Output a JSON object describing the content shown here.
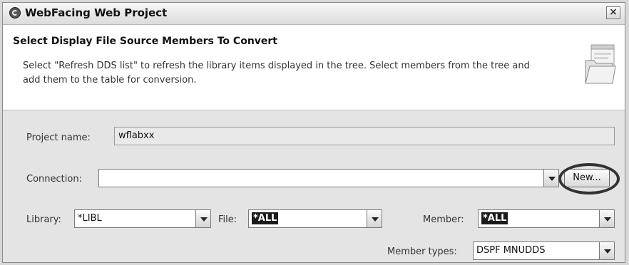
{
  "window": {
    "title": "WebFacing Web Project",
    "close_label": "×"
  },
  "header": {
    "title": "Select Display File Source Members To Convert",
    "description": "Select \"Refresh DDS list\" to refresh the library items displayed in the tree. Select members from the tree and add them to the table for conversion."
  },
  "form": {
    "project_name_label": "Project name:",
    "project_name_value": "wflabxx",
    "connection_label": "Connection:",
    "connection_value": "",
    "new_button_label": "New...",
    "library_label": "Library:",
    "library_value": "*LIBL",
    "file_label": "File:",
    "file_value": "*ALL",
    "member_label": "Member:",
    "member_value": "*ALL",
    "member_types_label": "Member types:",
    "member_types_value": "DSPF MNUDDS"
  }
}
